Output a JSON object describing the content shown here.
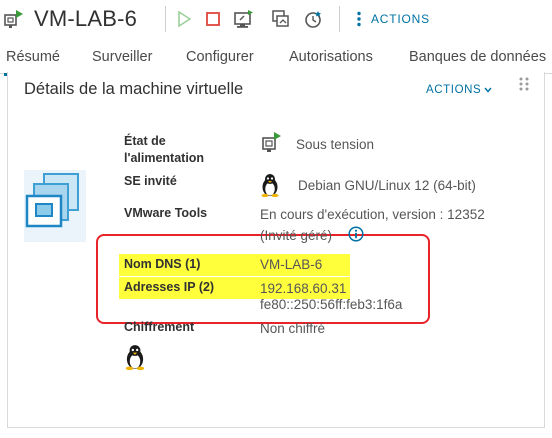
{
  "header": {
    "vm_name": "VM-LAB-6",
    "actions_label": "ACTIONS",
    "toolbar_icons": [
      "power-on-icon",
      "power-off-icon",
      "console-icon",
      "migrate-icon",
      "snapshot-icon"
    ]
  },
  "tabs": [
    {
      "label": "Résumé",
      "active": true
    },
    {
      "label": "Surveiller",
      "active": false
    },
    {
      "label": "Configurer",
      "active": false
    },
    {
      "label": "Autorisations",
      "active": false
    },
    {
      "label": "Banques de données",
      "active": false
    }
  ],
  "card": {
    "title": "Détails de la machine virtuelle",
    "actions_label": "ACTIONS",
    "rows": {
      "power": {
        "label_line1": "État de",
        "label_line2": "l'alimentation",
        "value": "Sous tension"
      },
      "guest_os": {
        "label": "SE invité",
        "value": "Debian GNU/Linux 12 (64-bit)"
      },
      "tools": {
        "label": "VMware Tools",
        "value_line1": "En cours d'exécution, version : 12352",
        "value_line2": "(Invité géré)"
      },
      "dns": {
        "label": "Nom DNS (1)",
        "value": "VM-LAB-6"
      },
      "ip": {
        "label": "Adresses IP (2)",
        "value1": "192.168.60.31",
        "value2": "fe80::250:56ff:feb3:1f6a"
      },
      "encryption": {
        "label": "Chiffrement",
        "value": "Non chiffré"
      }
    }
  },
  "colors": {
    "accent": "#0072a3",
    "highlight": "#ffff3c",
    "annotation": "#e8232a",
    "power_on": "#3a9a3a",
    "power_off": "#e0463a"
  }
}
